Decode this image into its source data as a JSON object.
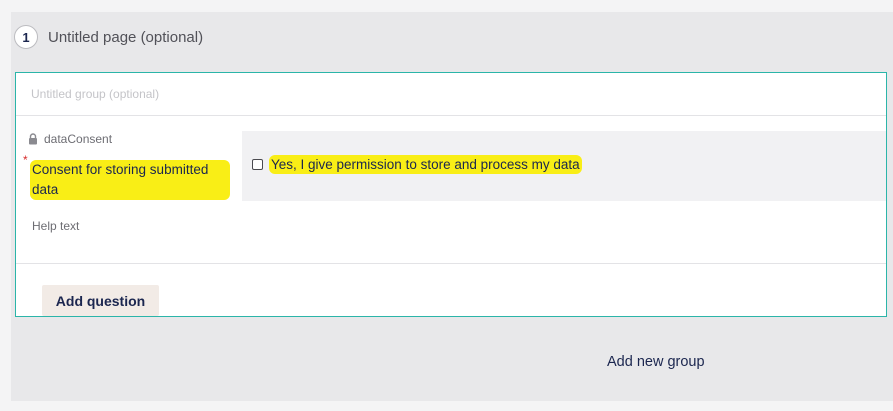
{
  "page": {
    "number": "1",
    "title": "Untitled page (optional)"
  },
  "group": {
    "title": "Untitled group (optional)",
    "add_question_label": "Add question"
  },
  "question": {
    "alias": "dataConsent",
    "alias_icon": "lock-icon",
    "required_mark": "*",
    "label": "Consent for storing submitted data",
    "help_text": "Help text",
    "choice_label": "Yes, I give permission to store and process my data",
    "choice_checked": false
  },
  "footer": {
    "add_group_label": "Add new group"
  },
  "colors": {
    "accent_border": "#2bb5a9",
    "highlight": "#f9ee16",
    "required": "#d62b2b",
    "text": "#1b264f"
  }
}
